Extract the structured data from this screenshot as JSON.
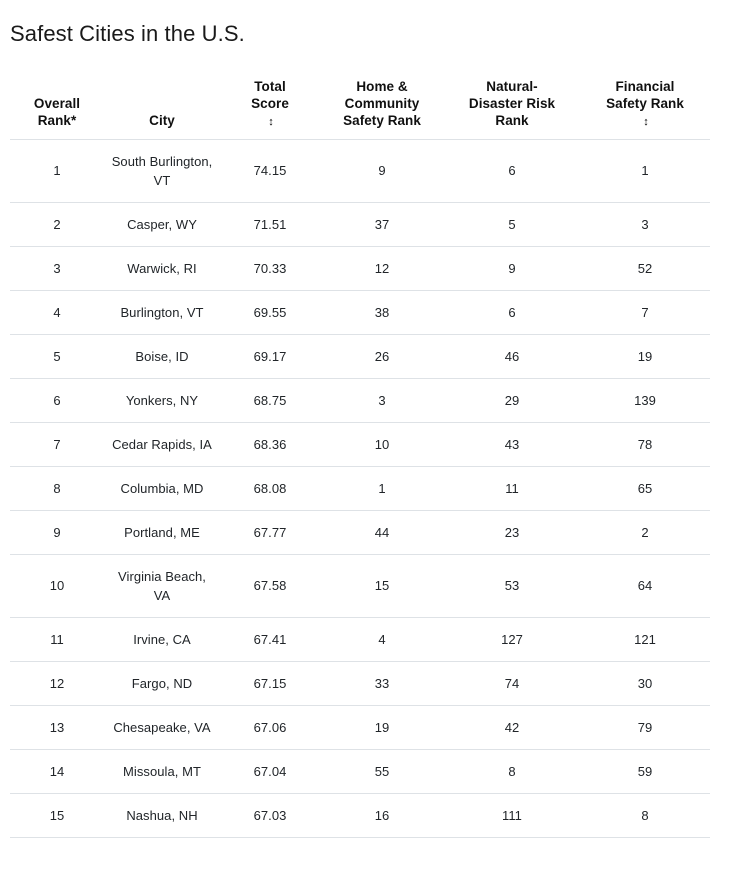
{
  "page": {
    "title": "Safest Cities in the U.S."
  },
  "table": {
    "sort_icon": "↕",
    "columns": [
      {
        "key": "rank",
        "label_lines": [
          "Overall",
          "Rank*"
        ],
        "sortable": true,
        "name": "column-overall-rank"
      },
      {
        "key": "city",
        "label_lines": [
          "City"
        ],
        "sortable": false,
        "name": "column-city"
      },
      {
        "key": "score",
        "label_lines": [
          "Total",
          "Score"
        ],
        "sortable": true,
        "name": "column-total-score"
      },
      {
        "key": "home",
        "label_lines": [
          "Home &",
          "Community",
          "Safety Rank"
        ],
        "sortable": true,
        "name": "column-home-community-safety-rank"
      },
      {
        "key": "nat",
        "label_lines": [
          "Natural-",
          "Disaster Risk",
          "Rank"
        ],
        "sortable": true,
        "name": "column-natural-disaster-risk-rank"
      },
      {
        "key": "fin",
        "label_lines": [
          "Financial",
          "Safety Rank"
        ],
        "sortable": true,
        "name": "column-financial-safety-rank"
      }
    ],
    "rows": [
      {
        "rank": "1",
        "city": "South Burlington, VT",
        "score": "74.15",
        "home": "9",
        "nat": "6",
        "fin": "1"
      },
      {
        "rank": "2",
        "city": "Casper, WY",
        "score": "71.51",
        "home": "37",
        "nat": "5",
        "fin": "3"
      },
      {
        "rank": "3",
        "city": "Warwick, RI",
        "score": "70.33",
        "home": "12",
        "nat": "9",
        "fin": "52"
      },
      {
        "rank": "4",
        "city": "Burlington, VT",
        "score": "69.55",
        "home": "38",
        "nat": "6",
        "fin": "7"
      },
      {
        "rank": "5",
        "city": "Boise, ID",
        "score": "69.17",
        "home": "26",
        "nat": "46",
        "fin": "19"
      },
      {
        "rank": "6",
        "city": "Yonkers, NY",
        "score": "68.75",
        "home": "3",
        "nat": "29",
        "fin": "139"
      },
      {
        "rank": "7",
        "city": "Cedar Rapids, IA",
        "score": "68.36",
        "home": "10",
        "nat": "43",
        "fin": "78"
      },
      {
        "rank": "8",
        "city": "Columbia, MD",
        "score": "68.08",
        "home": "1",
        "nat": "11",
        "fin": "65"
      },
      {
        "rank": "9",
        "city": "Portland, ME",
        "score": "67.77",
        "home": "44",
        "nat": "23",
        "fin": "2"
      },
      {
        "rank": "10",
        "city": "Virginia Beach, VA",
        "score": "67.58",
        "home": "15",
        "nat": "53",
        "fin": "64"
      },
      {
        "rank": "11",
        "city": "Irvine, CA",
        "score": "67.41",
        "home": "4",
        "nat": "127",
        "fin": "121"
      },
      {
        "rank": "12",
        "city": "Fargo, ND",
        "score": "67.15",
        "home": "33",
        "nat": "74",
        "fin": "30"
      },
      {
        "rank": "13",
        "city": "Chesapeake, VA",
        "score": "67.06",
        "home": "19",
        "nat": "42",
        "fin": "79"
      },
      {
        "rank": "14",
        "city": "Missoula, MT",
        "score": "67.04",
        "home": "55",
        "nat": "8",
        "fin": "59"
      },
      {
        "rank": "15",
        "city": "Nashua, NH",
        "score": "67.03",
        "home": "16",
        "nat": "111",
        "fin": "8"
      }
    ]
  },
  "colors": {
    "text": "#212529",
    "heading": "#1a1a1a",
    "divider": "#dee2e6",
    "background": "#ffffff"
  }
}
